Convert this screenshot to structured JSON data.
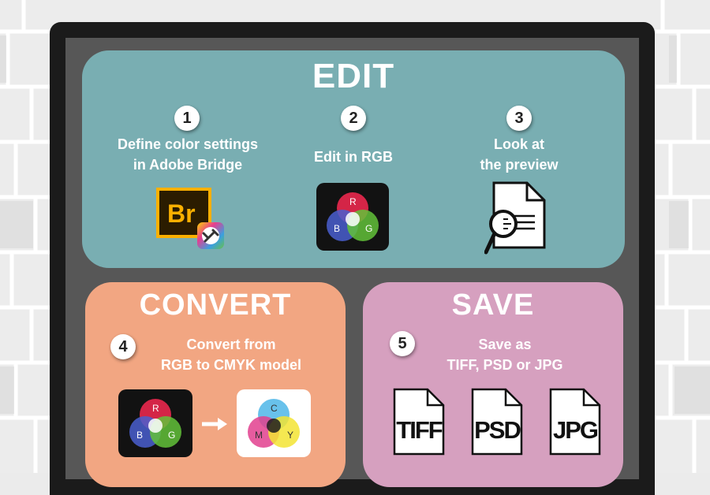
{
  "edit": {
    "title": "EDIT",
    "steps": [
      {
        "number": "1",
        "line1": "Define color settings",
        "line2": "in Adobe Bridge",
        "icon": "adobe-bridge-icon",
        "icon_text": "Br"
      },
      {
        "number": "2",
        "line1": "Edit in RGB",
        "line2": "",
        "icon": "rgb-color-icon",
        "letters": [
          "R",
          "B",
          "G"
        ]
      },
      {
        "number": "3",
        "line1": "Look at",
        "line2": "the preview",
        "icon": "document-magnifier-icon"
      }
    ]
  },
  "convert": {
    "title": "CONVERT",
    "step": {
      "number": "4",
      "line1": "Convert from",
      "line2": "RGB to CMYK model"
    },
    "rgb_letters": [
      "R",
      "B",
      "G"
    ],
    "cmyk_letters": [
      "C",
      "M",
      "Y"
    ]
  },
  "save": {
    "title": "SAVE",
    "step": {
      "number": "5",
      "line1": "Save as",
      "line2": "TIFF, PSD or JPG"
    },
    "formats": [
      "TIFF",
      "PSD",
      "JPG"
    ]
  },
  "colors": {
    "edit_panel": "#79aeb2",
    "convert_panel": "#f2a682",
    "save_panel": "#d6a0bf",
    "board_frame": "#1b1b1b",
    "board_fill": "#575757"
  }
}
